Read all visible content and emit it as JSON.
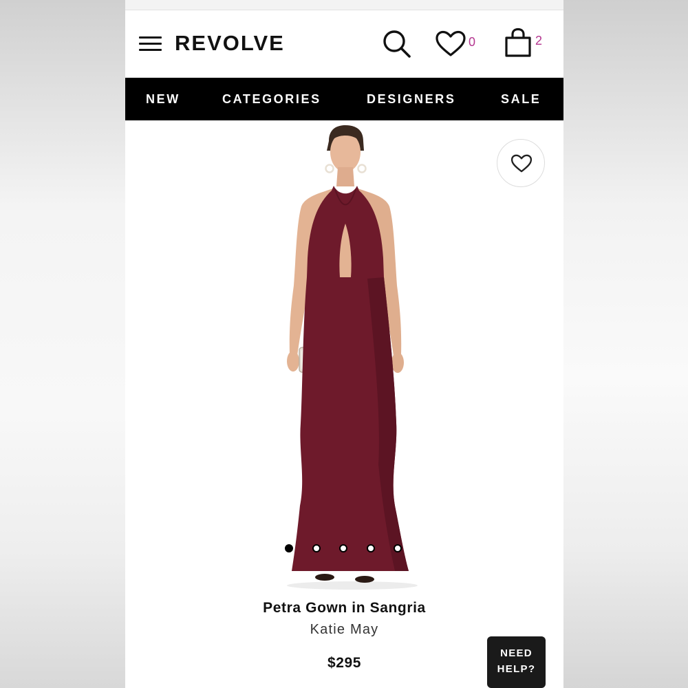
{
  "header": {
    "logo_text": "REVOLVE",
    "wishlist_count": "0",
    "bag_count": "2",
    "accent_color": "#b4358f"
  },
  "nav": {
    "items": [
      "NEW",
      "CATEGORIES",
      "DESIGNERS",
      "SALE"
    ]
  },
  "product": {
    "name": "Petra Gown in Sangria",
    "designer": "Katie May",
    "price": "$295",
    "dress_color": "#6e1a2b",
    "carousel": {
      "total_images": 5,
      "active_index": 0
    }
  },
  "help": {
    "line1": "NEED",
    "line2": "HELP?"
  },
  "icons": [
    "menu-icon",
    "search-icon",
    "heart-icon",
    "shopping-bag-icon",
    "heart-outline-icon"
  ]
}
